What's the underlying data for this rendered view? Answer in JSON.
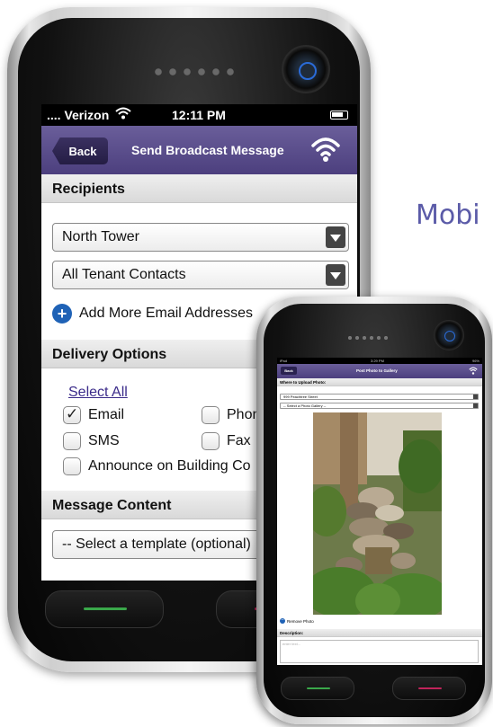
{
  "heading_fragment": "Mobi",
  "phone_main": {
    "status": {
      "carrier": ".... Verizon",
      "time": "12:11 PM"
    },
    "nav": {
      "back_label": "Back",
      "title": "Send Broadcast Message"
    },
    "recipients": {
      "section_label": "Recipients",
      "building_select": "North Tower",
      "contacts_select": "All Tenant Contacts",
      "add_more_label": "Add More Email Addresses"
    },
    "delivery": {
      "section_label": "Delivery Options",
      "select_all_label": "Select All",
      "options": [
        {
          "label": "Email",
          "checked": true
        },
        {
          "label": "Phone",
          "checked": false
        },
        {
          "label": "SMS",
          "checked": false
        },
        {
          "label": "Fax",
          "checked": false
        },
        {
          "label": "Announce on Building Co",
          "checked": false
        }
      ]
    },
    "message": {
      "section_label": "Message Content",
      "template_select": "-- Select a template (optional)"
    }
  },
  "phone_small": {
    "status": {
      "device": "iPad",
      "time": "3:29 PM",
      "battery": "96%"
    },
    "nav": {
      "back_label": "Back",
      "title": "Post Photo to Gallery"
    },
    "upload_section_label": "Where to Upload Photo:",
    "address_select": "999 Peachtree Street",
    "gallery_select": "-- Select a Photo Gallery --",
    "remove_photo_label": "Remove Photo",
    "description_label": "Description:",
    "description_placeholder": "enter text..."
  },
  "colors": {
    "nav_purple": "#4c3f7e",
    "heading_purple": "#5b5ba8",
    "link_blue": "#1f62b6",
    "home_green": "#3aa84a",
    "home_red": "#c0245a"
  }
}
